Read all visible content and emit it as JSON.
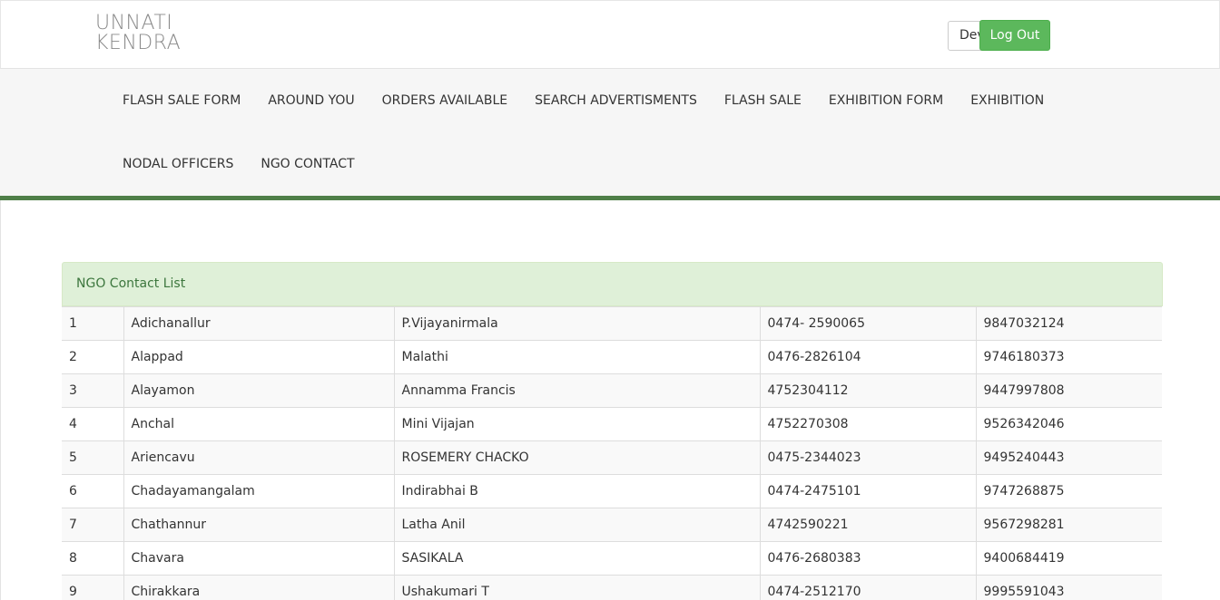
{
  "brand": {
    "line1": "UNNATI",
    "line2": "KENDRA"
  },
  "header": {
    "dev_button_label": "Dev",
    "logout_label": "Log Out"
  },
  "nav": {
    "row1": [
      "FLASH SALE FORM",
      "AROUND YOU",
      "ORDERS AVAILABLE",
      "SEARCH ADVERTISMENTS",
      "FLASH SALE",
      "EXHIBITION FORM",
      "EXHIBITION"
    ],
    "row2": [
      "NODAL OFFICERS",
      "NGO CONTACT"
    ]
  },
  "colors": {
    "accent_green": "#5cb85c",
    "nav_rule": "#4f7f48",
    "panel_heading_bg": "#dff0d8",
    "panel_heading_text": "#3c763d"
  },
  "panel": {
    "title": "NGO Contact List",
    "rows": [
      [
        "1",
        "Adichanallur",
        "P.Vijayanirmala",
        "0474- 2590065",
        "9847032124"
      ],
      [
        "2",
        "Alappad",
        "Malathi",
        "0476-2826104",
        "9746180373"
      ],
      [
        "3",
        "Alayamon",
        "Annamma Francis",
        "4752304112",
        "9447997808"
      ],
      [
        "4",
        "Anchal",
        "Mini Vijajan",
        "4752270308",
        "9526342046"
      ],
      [
        "5",
        "Ariencavu",
        "ROSEMERY CHACKO",
        "0475-2344023",
        "9495240443"
      ],
      [
        "6",
        "Chadayamangalam",
        "Indirabhai B",
        "0474-2475101",
        "9747268875"
      ],
      [
        "7",
        "Chathannur",
        "Latha Anil",
        "4742590221",
        "9567298281"
      ],
      [
        "8",
        "Chavara",
        "SASIKALA",
        "0476-2680383",
        "9400684419"
      ],
      [
        "9",
        "Chirakkara",
        "Ushakumari T",
        "0474-2512170",
        "9995591043"
      ]
    ]
  }
}
